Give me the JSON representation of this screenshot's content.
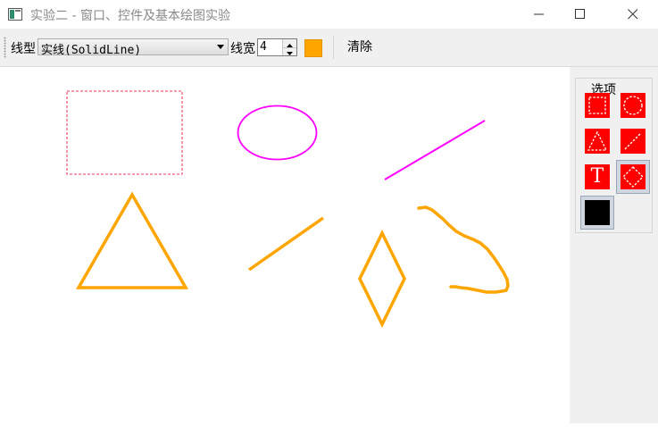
{
  "window": {
    "title": "实验二 - 窗口、控件及基本绘图实验",
    "icon": "app-window-icon",
    "controls": [
      "minimize-icon",
      "maximize-icon",
      "close-icon"
    ]
  },
  "toolbar": {
    "line_type_label": "线型",
    "line_type_value": "实线(SolidLine)",
    "line_width_label": "线宽",
    "line_width_value": "4",
    "pen_color": "#ffa500",
    "clear_label": "清除"
  },
  "options_panel": {
    "title": "选项",
    "tools": [
      {
        "name": "rectangle-tool",
        "icon": "dashed-rectangle-icon",
        "checked": false
      },
      {
        "name": "ellipse-tool",
        "icon": "dashed-circle-icon",
        "checked": false
      },
      {
        "name": "triangle-tool",
        "icon": "dashed-triangle-icon",
        "checked": false
      },
      {
        "name": "line-tool",
        "icon": "dashed-line-icon",
        "checked": false
      },
      {
        "name": "text-tool",
        "icon": "text-icon",
        "label": "T",
        "checked": false
      },
      {
        "name": "diamond-tool",
        "icon": "dashed-diamond-icon",
        "checked": true
      },
      {
        "name": "freehand-tool",
        "icon": "black-square-icon",
        "checked": false
      }
    ]
  },
  "colors": {
    "shape_pink": "#f35b7a",
    "shape_magenta": "#ff00ff",
    "shape_orange": "#ffa500",
    "tool_red": "#ff0000"
  }
}
